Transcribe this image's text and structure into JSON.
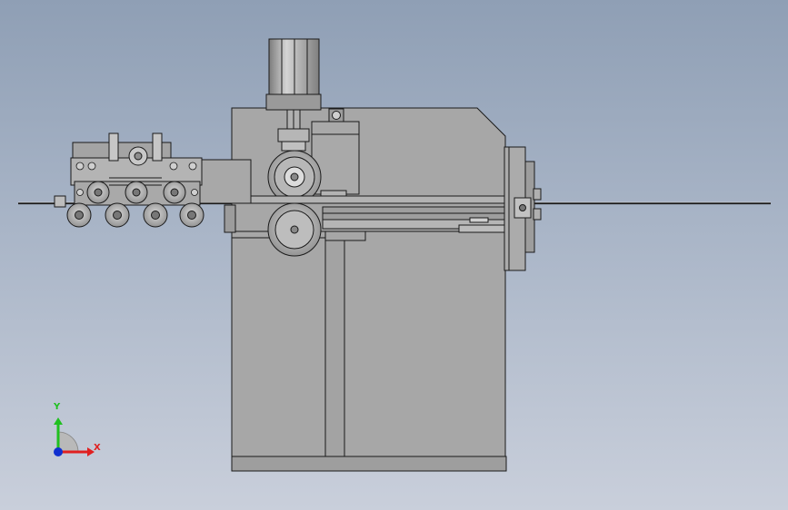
{
  "triad": {
    "x_label": "X",
    "y_label": "Y",
    "x_color": "#e02020",
    "y_color": "#20c020",
    "z_color": "#1030d0"
  },
  "colors": {
    "background_top": "#8f9fb5",
    "background_bottom": "#c9cfdb",
    "part_fill": "#a7a7a7",
    "part_dark": "#8a8a8a",
    "edge": "#1a1a1a"
  }
}
